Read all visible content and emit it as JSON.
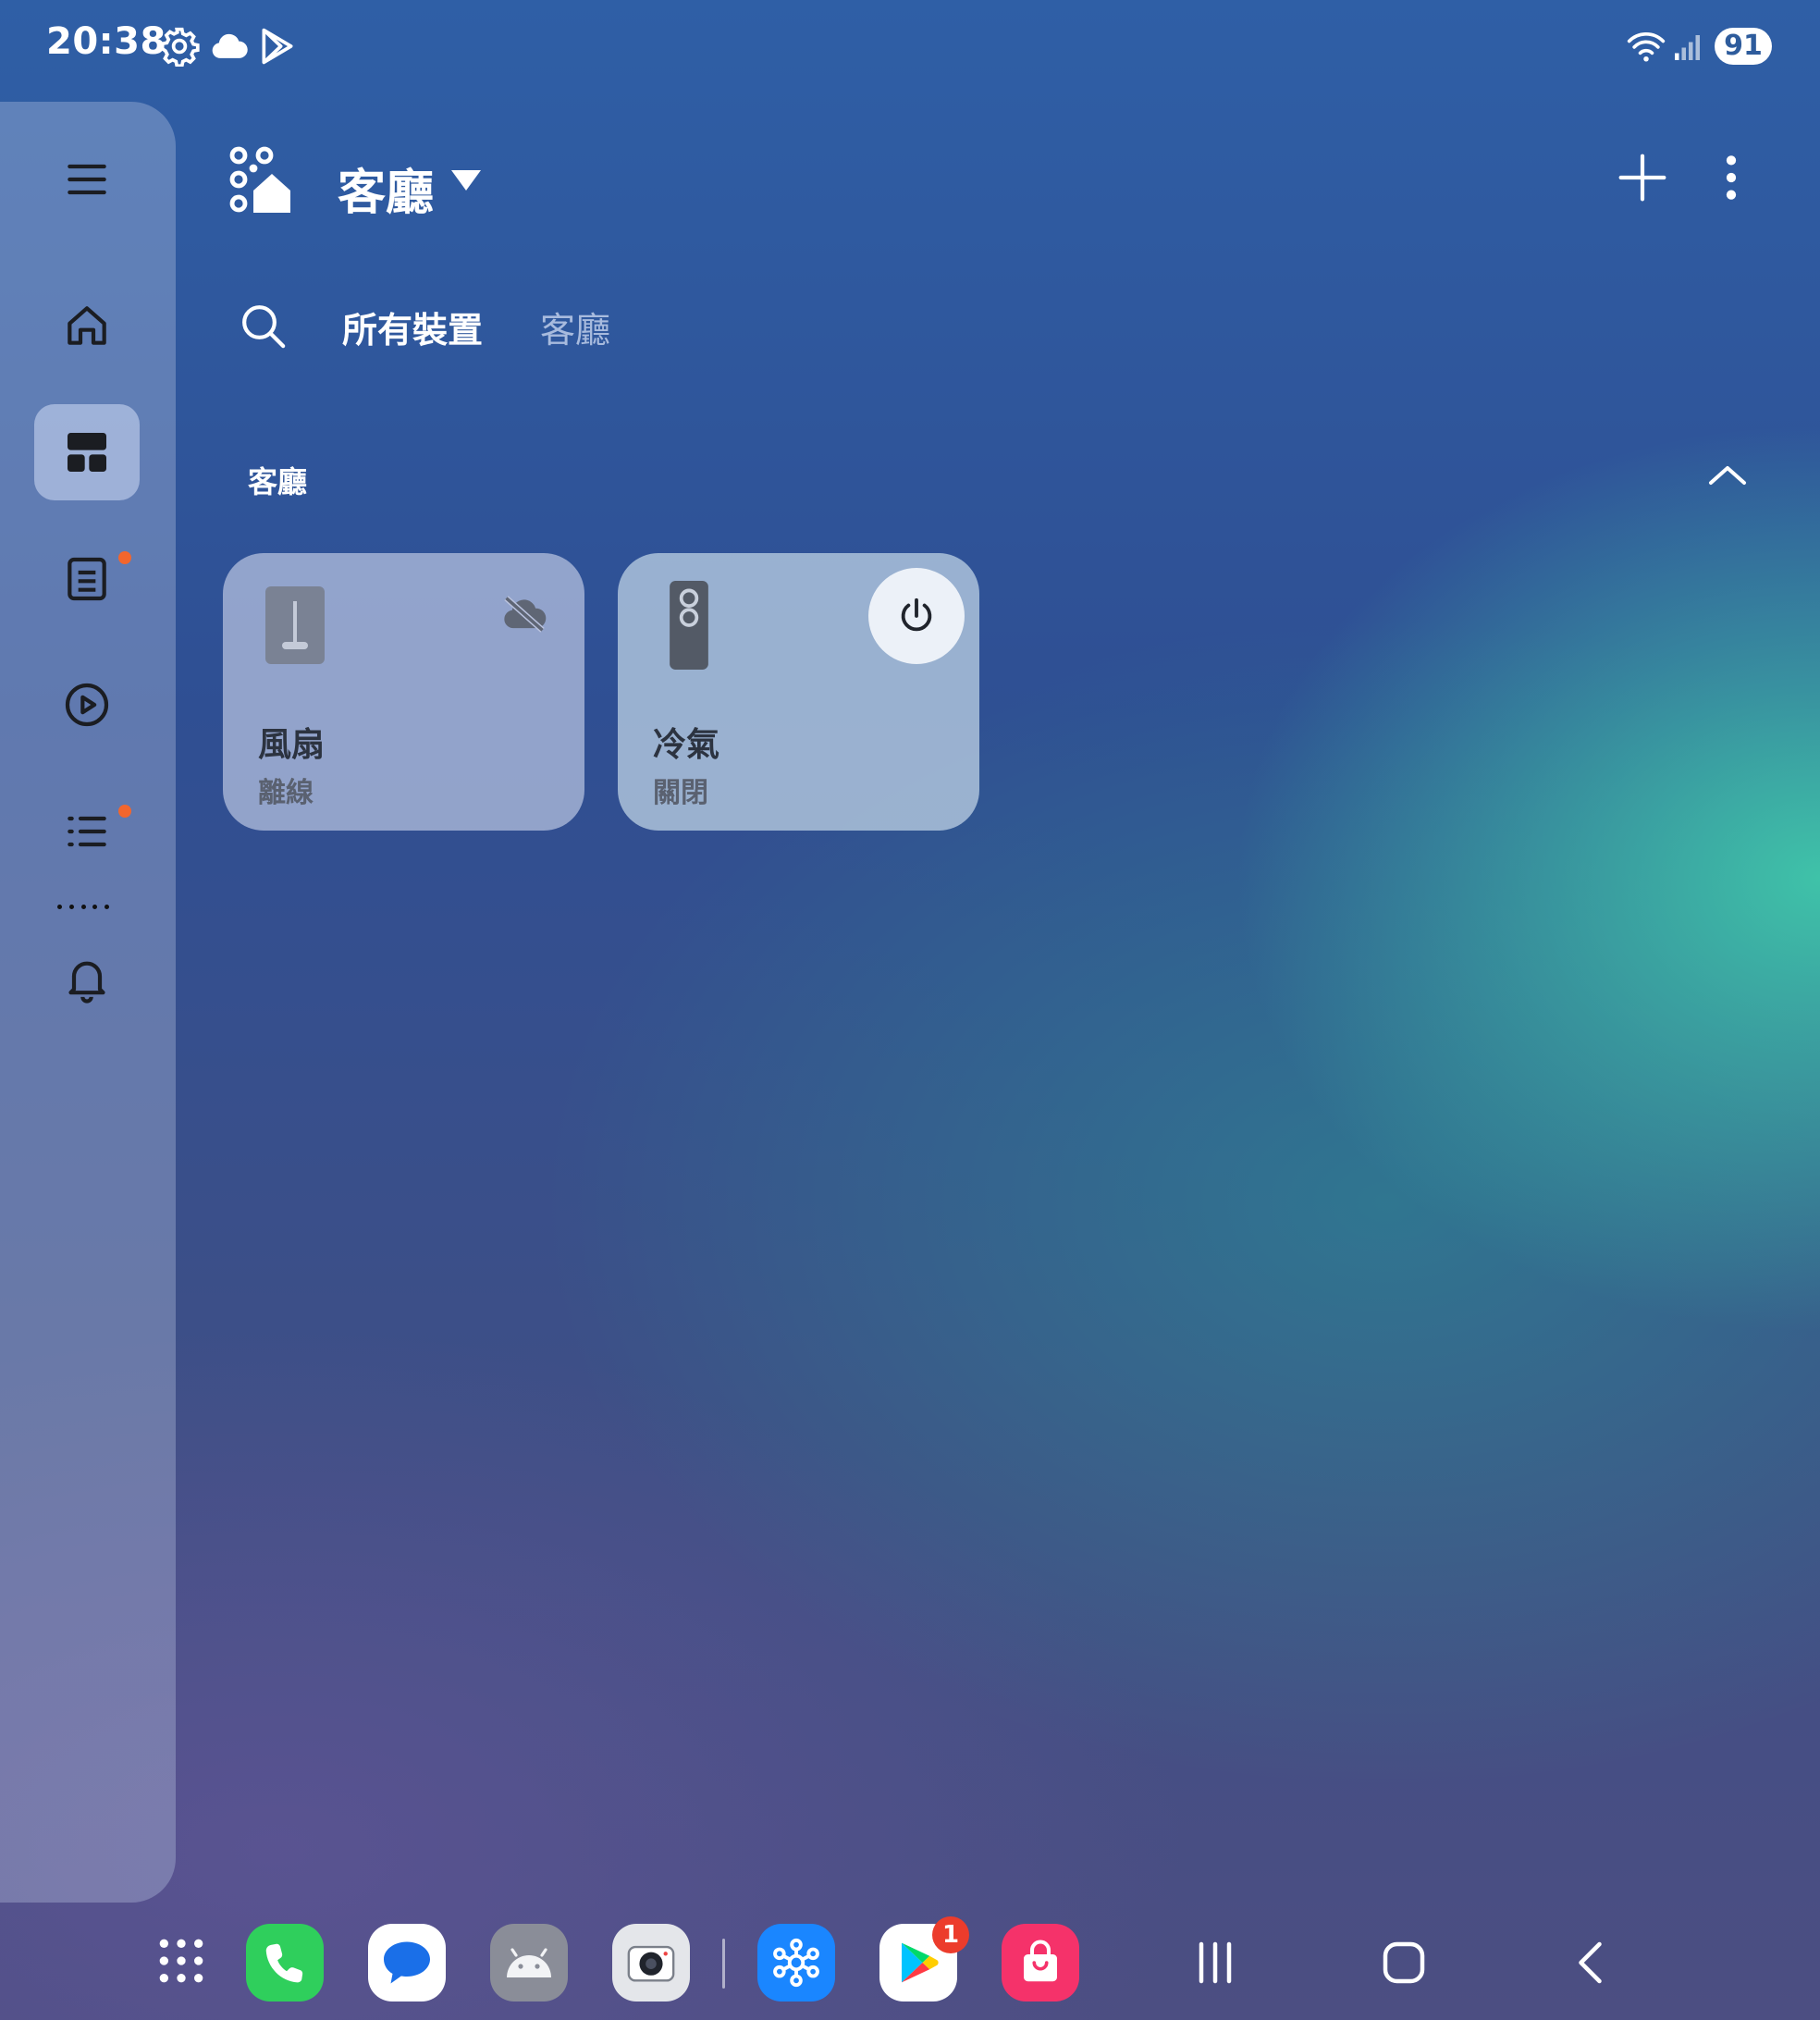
{
  "status_bar": {
    "time": "20:38",
    "icons": [
      "gear-icon",
      "cloud-icon",
      "play-store-outline-icon"
    ],
    "right_icons": [
      "wifi-icon",
      "signal-icon"
    ],
    "battery": "91"
  },
  "side_rail": {
    "items": [
      {
        "name": "menu",
        "icon": "hamburger-icon"
      },
      {
        "name": "home",
        "icon": "home-icon"
      },
      {
        "name": "devices",
        "icon": "dashboard-icon",
        "active": true
      },
      {
        "name": "life",
        "icon": "notes-icon",
        "badge": true
      },
      {
        "name": "automations",
        "icon": "play-circle-icon"
      },
      {
        "name": "menu-list",
        "icon": "list-icon",
        "badge": true
      },
      {
        "name": "notifications",
        "icon": "bell-icon"
      }
    ],
    "badge_color": "#f2662d"
  },
  "header": {
    "title": "客廳",
    "logo_icon": "smartthings-home-icon"
  },
  "tabs": {
    "all": "所有裝置",
    "room": "客廳"
  },
  "section": {
    "title": "客廳"
  },
  "devices": [
    {
      "name": "風扇",
      "status": "離線",
      "icon": "fan-device-icon",
      "offline_icon": "cloud-off-icon"
    },
    {
      "name": "冷氣",
      "status": "關閉",
      "icon": "remote-device-icon",
      "action_icon": "power-icon"
    }
  ],
  "dock": {
    "apps": [
      "apps-grid-icon",
      "phone-app-icon",
      "messages-app-icon",
      "android-app-icon",
      "camera-app-icon",
      "smartthings-app-icon",
      "play-store-app-icon",
      "galaxy-store-app-icon"
    ],
    "play_store_badge": "1",
    "nav": [
      "recents-icon",
      "home-nav-icon",
      "back-icon"
    ]
  },
  "colors": {
    "accent_badge": "#ec3c2c",
    "phone_green": "#2fcf5c",
    "smartthings_blue": "#1a86ff",
    "store_pink": "#f5326a"
  }
}
